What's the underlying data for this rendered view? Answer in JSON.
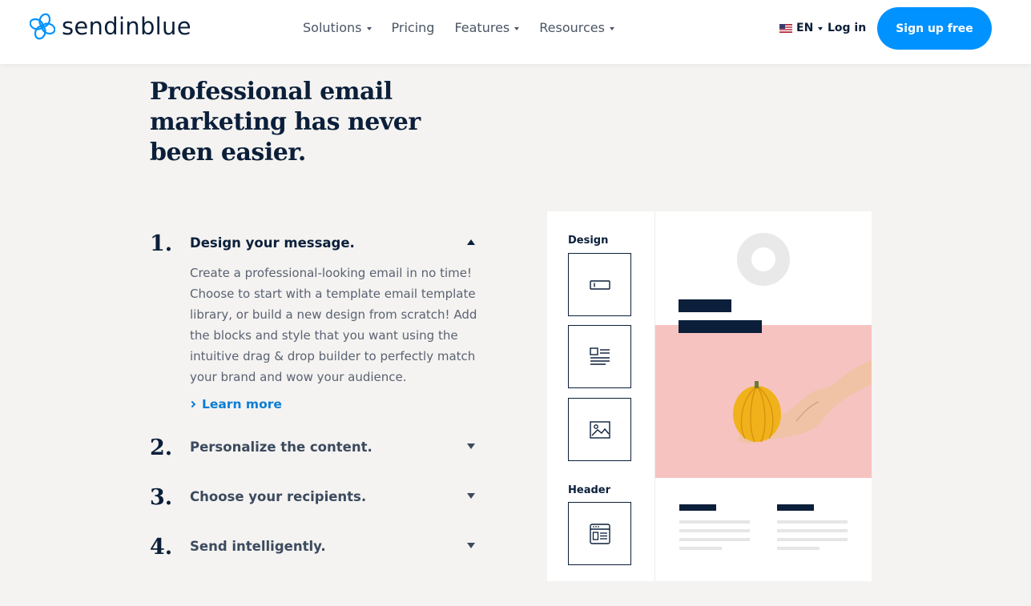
{
  "brand": {
    "name": "sendinblue",
    "accent": "#0092ff",
    "navy": "#0b1f3a"
  },
  "nav": [
    {
      "label": "Solutions",
      "dropdown": true
    },
    {
      "label": "Pricing",
      "dropdown": false
    },
    {
      "label": "Features",
      "dropdown": true
    },
    {
      "label": "Resources",
      "dropdown": true
    }
  ],
  "header": {
    "language": "EN",
    "login": "Log in",
    "signup": "Sign up free"
  },
  "hero": {
    "headline": "Professional email marketing has never been easier."
  },
  "steps": [
    {
      "number": "1.",
      "title": "Design your message.",
      "expanded": true,
      "description": "Create a professional-looking email in no time! Choose to start with a template email template library, or build a new design from scratch! Add the blocks and style that you want using the intuitive drag & drop builder to perfectly match your brand and wow your audience.",
      "link": "Learn more"
    },
    {
      "number": "2.",
      "title": "Personalize the content.",
      "expanded": false
    },
    {
      "number": "3.",
      "title": "Choose your recipients.",
      "expanded": false
    },
    {
      "number": "4.",
      "title": "Send intelligently.",
      "expanded": false
    }
  ],
  "builder": {
    "sections": [
      "Design",
      "Header"
    ],
    "blocks": [
      "text-block-icon",
      "text-image-block-icon",
      "image-block-icon",
      "header-block-icon"
    ]
  }
}
